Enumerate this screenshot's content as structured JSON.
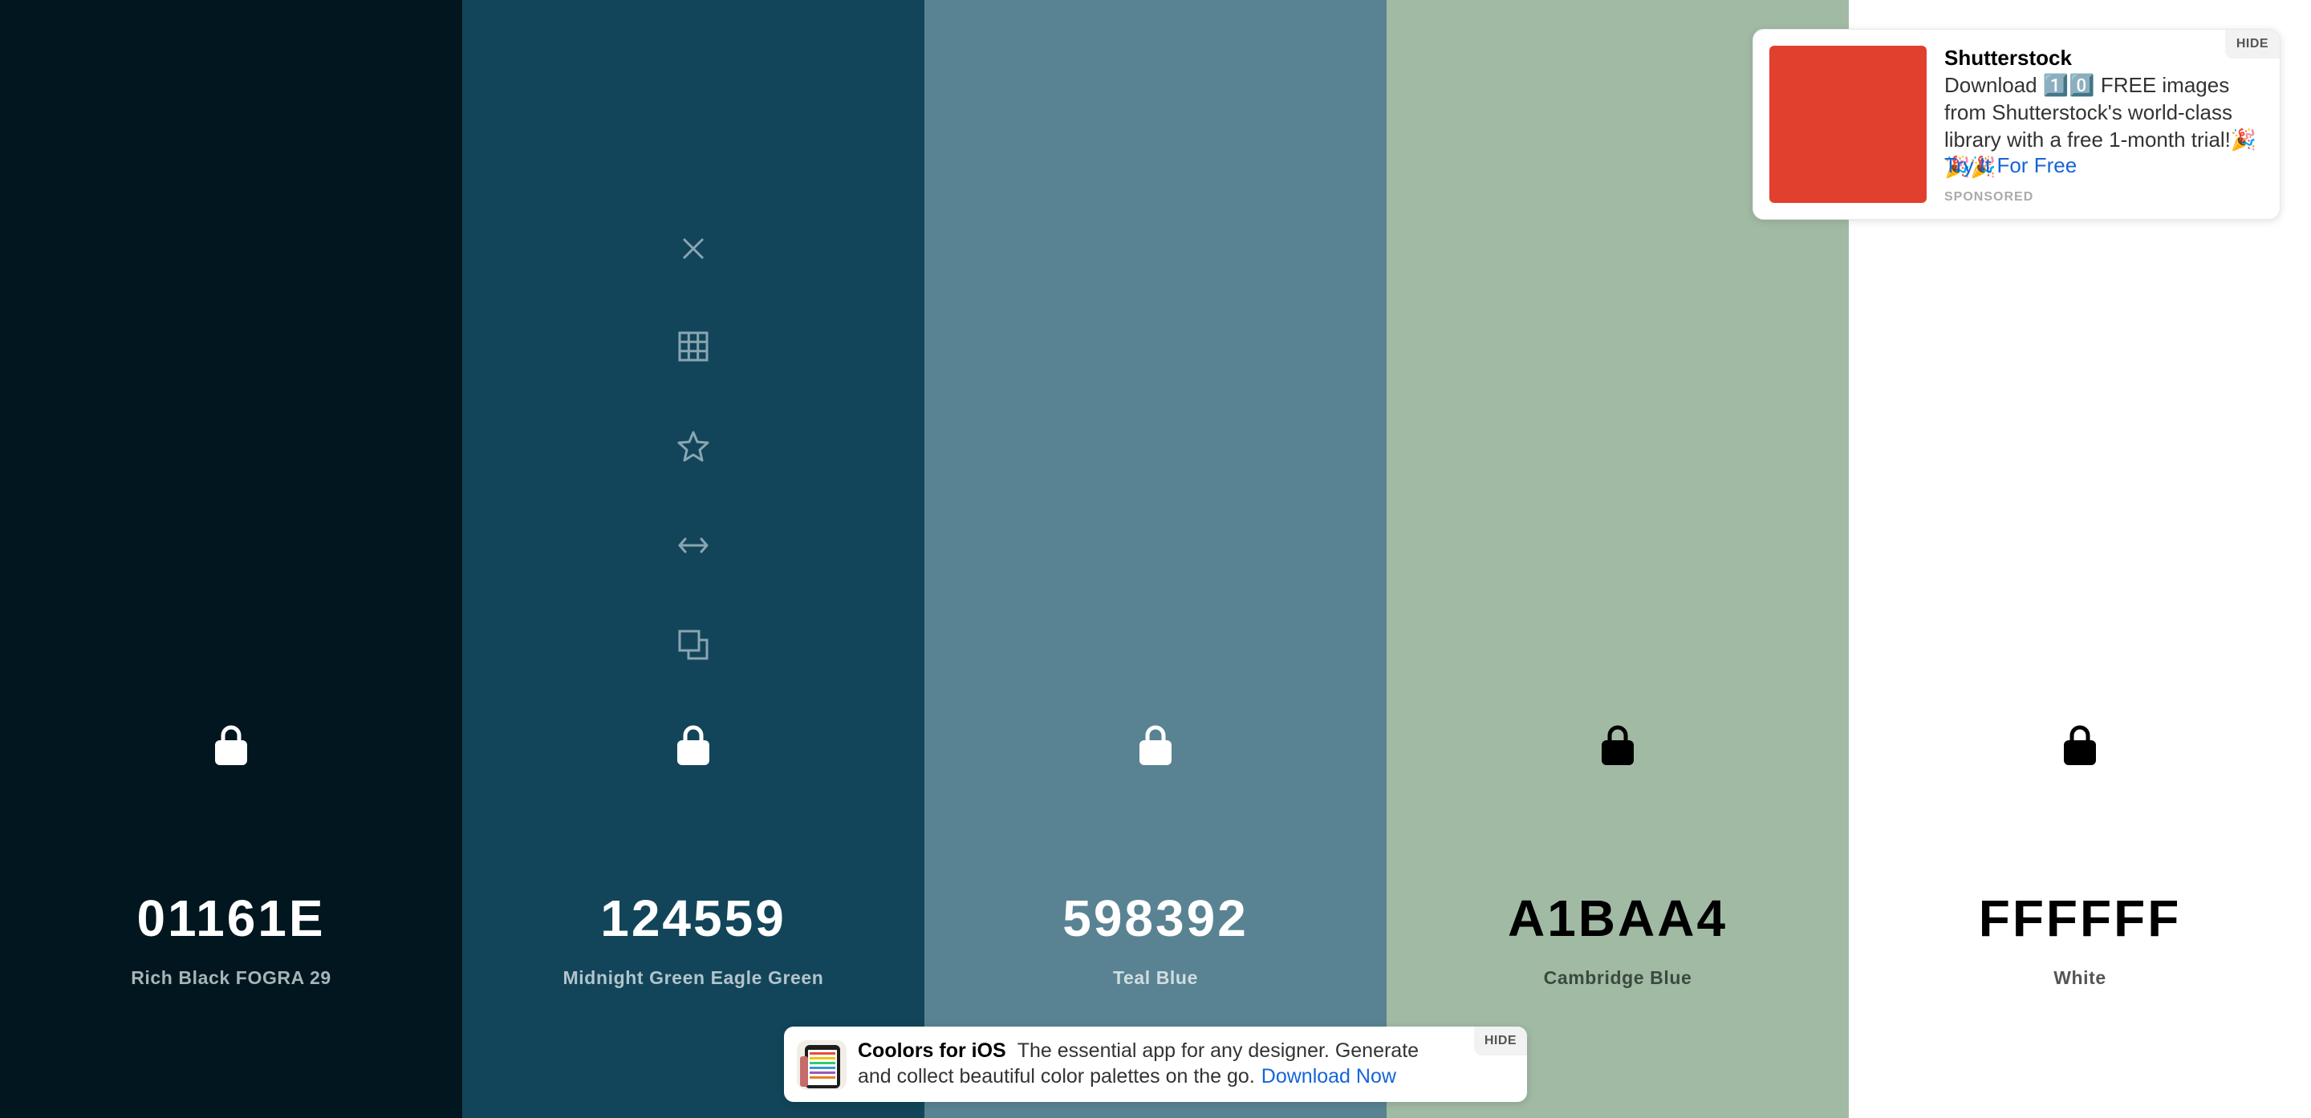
{
  "palette": [
    {
      "hex": "01161E",
      "name": "Rich Black FOGRA 29",
      "bg": "#01161e",
      "hex_color": "#ffffff",
      "name_color": "#a7b4b9",
      "lock_color": "#ffffff"
    },
    {
      "hex": "124559",
      "name": "Midnight Green Eagle Green",
      "bg": "#124559",
      "hex_color": "#ffffff",
      "name_color": "#b3c4cc",
      "lock_color": "#ffffff"
    },
    {
      "hex": "598392",
      "name": "Teal Blue",
      "bg": "#598392",
      "hex_color": "#ffffff",
      "name_color": "#d0dde2",
      "lock_color": "#ffffff"
    },
    {
      "hex": "A1BAA4",
      "name": "Cambridge Blue",
      "bg": "#a1baa4",
      "hex_color": "#000000",
      "name_color": "#3b4a3e",
      "lock_color": "#000000"
    },
    {
      "hex": "FFFFFF",
      "name": "White",
      "bg": "#ffffff",
      "hex_color": "#000000",
      "name_color": "#555555",
      "lock_color": "#000000"
    }
  ],
  "tools": [
    "close-icon",
    "grid-icon",
    "star-icon",
    "drag-arrows-icon",
    "copy-icon"
  ],
  "tool_color": "#8aa5b2",
  "ad": {
    "title": "Shutterstock",
    "body": "Download 1️⃣0️⃣ FREE images from Shutterstock's world-class library with a free 1-month trial!🎉🎉🎉",
    "cta": "Try It For Free",
    "sponsored": "SPONSORED",
    "hide": "HIDE",
    "thumb_color": "#e0402d"
  },
  "banner": {
    "title": "Coolors for iOS",
    "text": "The essential app for any designer. Generate and collect beautiful color palettes on the go.",
    "link": "Download Now",
    "hide": "HIDE"
  }
}
